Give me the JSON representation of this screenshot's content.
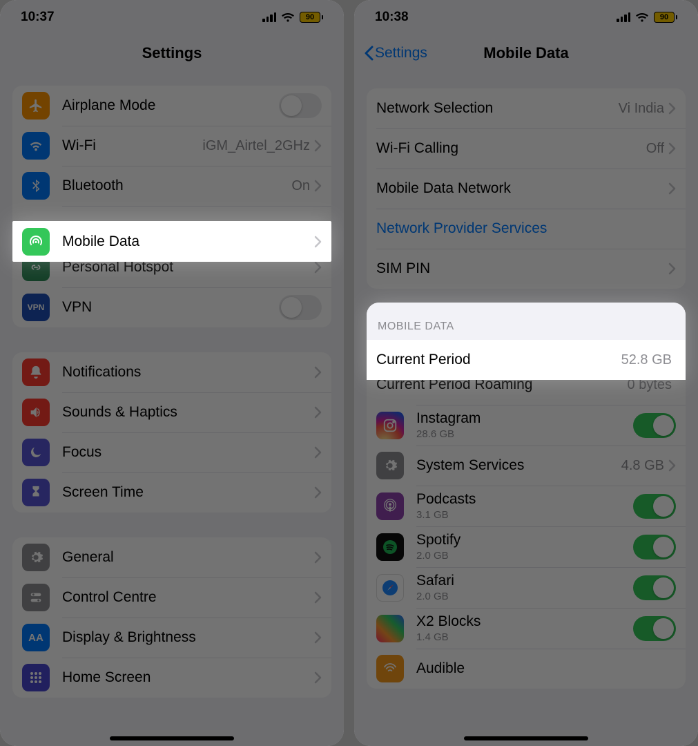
{
  "left": {
    "status": {
      "time": "10:37",
      "battery": "90"
    },
    "title": "Settings",
    "rows": {
      "airplane": "Airplane Mode",
      "wifi": "Wi-Fi",
      "wifi_detail": "iGM_Airtel_2GHz",
      "bluetooth": "Bluetooth",
      "bluetooth_detail": "On",
      "mobile_data": "Mobile Data",
      "hotspot": "Personal Hotspot",
      "vpn": "VPN",
      "notifications": "Notifications",
      "sounds": "Sounds & Haptics",
      "focus": "Focus",
      "screen_time": "Screen Time",
      "general": "General",
      "control_centre": "Control Centre",
      "display": "Display & Brightness",
      "home_screen": "Home Screen"
    }
  },
  "right": {
    "status": {
      "time": "10:38",
      "battery": "90"
    },
    "back": "Settings",
    "title": "Mobile Data",
    "rows": {
      "net_sel": "Network Selection",
      "net_sel_detail": "Vi India",
      "wifi_calling": "Wi-Fi Calling",
      "wifi_calling_detail": "Off",
      "mobile_net": "Mobile Data Network",
      "provider_services": "Network Provider Services",
      "sim_pin": "SIM PIN"
    },
    "section_header": "MOBILE DATA",
    "usage": {
      "current": "Current Period",
      "current_val": "52.8 GB",
      "roaming": "Current Period Roaming",
      "roaming_val": "0 bytes"
    },
    "apps": {
      "instagram": {
        "name": "Instagram",
        "size": "28.6 GB"
      },
      "system": {
        "name": "System Services",
        "size": "4.8 GB"
      },
      "podcasts": {
        "name": "Podcasts",
        "size": "3.1 GB"
      },
      "spotify": {
        "name": "Spotify",
        "size": "2.0 GB"
      },
      "safari": {
        "name": "Safari",
        "size": "2.0 GB"
      },
      "x2": {
        "name": "X2 Blocks",
        "size": "1.4 GB"
      },
      "audible": {
        "name": "Audible"
      }
    }
  }
}
